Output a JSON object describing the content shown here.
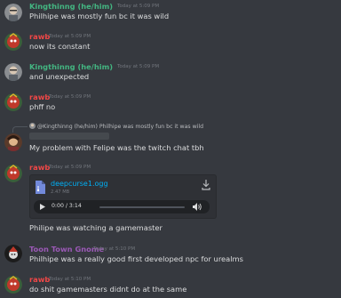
{
  "messages": [
    {
      "id": "m1",
      "author": "Kingthinng (he/him)",
      "author_color": "#43b581",
      "timestamp": "Today at 5:09 PM",
      "lines": [
        "Philhipe was mostly fun bc it was wild"
      ],
      "avatar": "gray"
    },
    {
      "id": "m2",
      "author": "rawb",
      "author_color": "#f04747",
      "timestamp": "Today at 5:09 PM",
      "lines": [
        "now its constant"
      ],
      "avatar": "red"
    },
    {
      "id": "m3",
      "author": "Kingthinng (he/him)",
      "author_color": "#43b581",
      "timestamp": "Today at 5:09 PM",
      "lines": [
        "and unexpected"
      ],
      "avatar": "gray"
    },
    {
      "id": "m4",
      "author": "rawb",
      "author_color": "#f04747",
      "timestamp": "Today at 5:09 PM",
      "lines": [
        "phff no"
      ],
      "avatar": "red"
    },
    {
      "id": "m5",
      "reply_to": "@Kingthinng (he/him) Philhipe was mostly fun bc it was wild",
      "lines": [
        "My problem with Felipe was the twitch chat tbh"
      ],
      "avatar": "brown"
    },
    {
      "id": "m6",
      "author": "rawb",
      "author_color": "#f04747",
      "timestamp": "Today at 5:09 PM",
      "avatar": "red",
      "attachment": {
        "file_name": "deepcurse1.ogg",
        "file_size": "2.47 MB",
        "time": "0:00 / 3:14",
        "progress": 0.0
      },
      "lines": [
        "Philipe was watching a gamemaster"
      ]
    },
    {
      "id": "m7",
      "author": "Toon Town Gnome",
      "author_color": "#9b59b6",
      "timestamp": "Today at 5:10 PM",
      "lines": [
        "Philhipe was a really good first developed npc for urealms"
      ],
      "avatar": "dark"
    },
    {
      "id": "m8",
      "author": "rawb",
      "author_color": "#f04747",
      "timestamp": "Today at 5:10 PM",
      "lines": [
        "do shit gamemasters didnt do at the same"
      ],
      "avatar": "red"
    }
  ],
  "colors": {
    "background": "#36393f",
    "link": "#00aff4",
    "muted": "#72767d"
  },
  "icons": {
    "download": "download-icon",
    "play": "play-icon",
    "volume": "volume-icon",
    "file": "file-audio-icon",
    "reply": "reply-icon"
  }
}
